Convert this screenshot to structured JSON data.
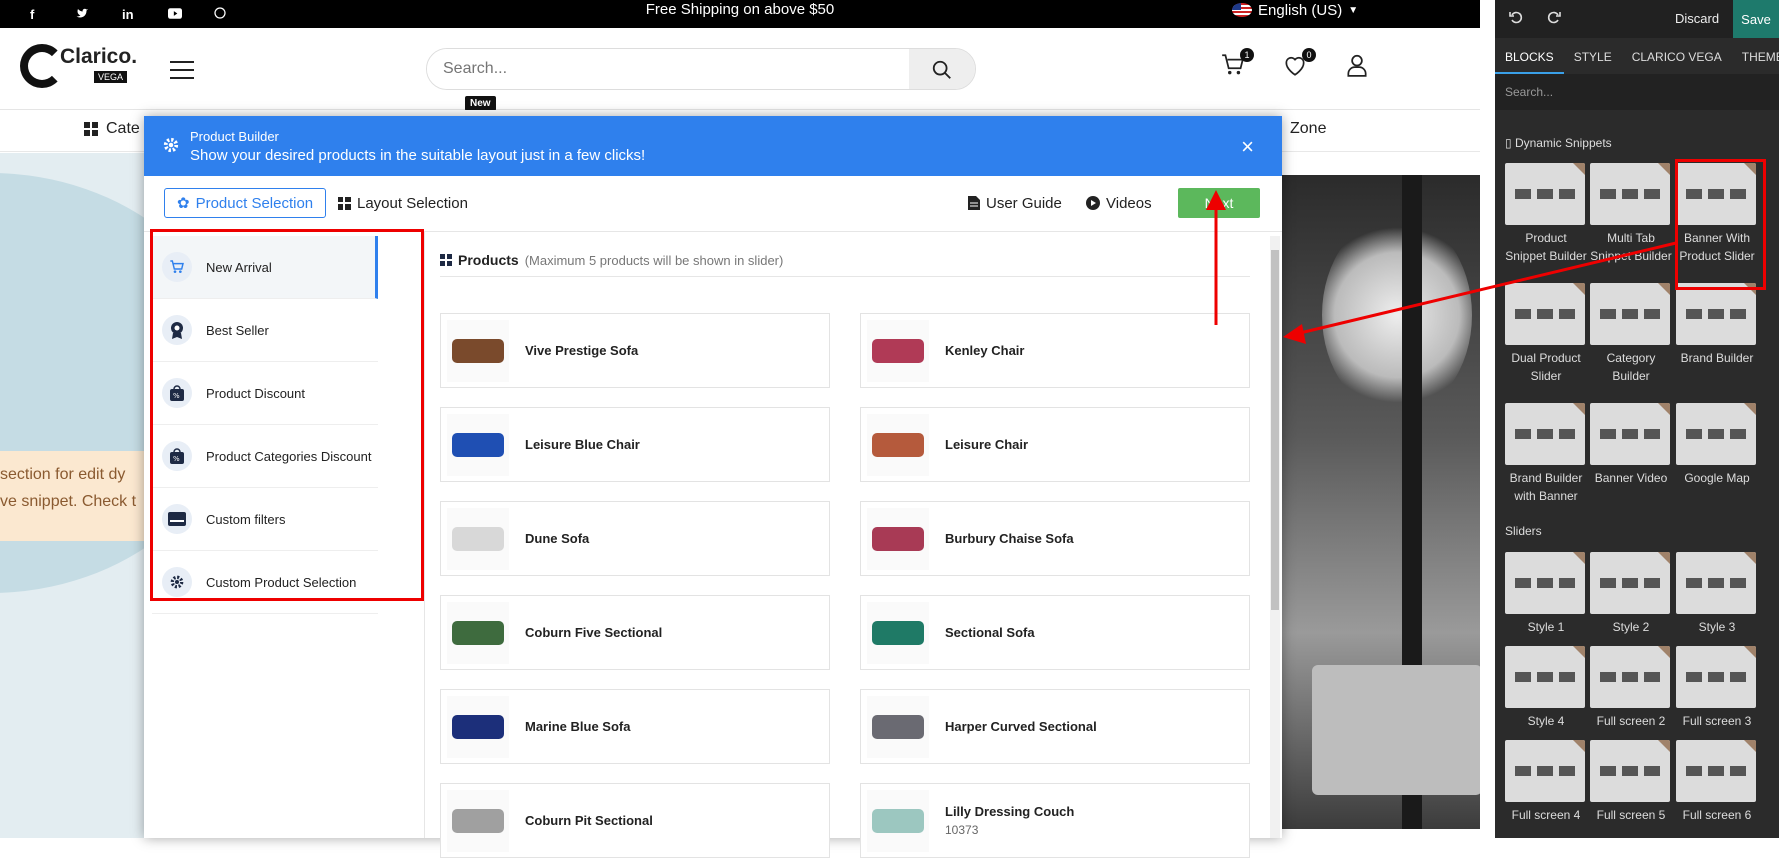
{
  "topbar": {
    "socials": [
      "f",
      "t",
      "in",
      "yt",
      "gh"
    ],
    "shipping": "Free Shipping on above $50",
    "language": "English (US)"
  },
  "header": {
    "logo_text": "Clarico.",
    "logo_badge": "VEGA",
    "search_placeholder": "Search...",
    "cart_count": "1",
    "wishlist_count": "0",
    "new_tag": "New"
  },
  "subnav": {
    "category_label": "Cate",
    "zone_label": "Zone"
  },
  "hero": {
    "notice_line1": "section for edit dy",
    "notice_line2": "ve snippet. Check t"
  },
  "modal": {
    "title": "Product Builder",
    "subtitle": "Show your desired products in the suitable layout just in a few clicks!",
    "tab_product_selection": "Product Selection",
    "tab_layout_selection": "Layout Selection",
    "user_guide": "User Guide",
    "videos": "Videos",
    "next": "Next",
    "close": "×",
    "products_title": "Products",
    "products_note": "(Maximum 5 products will be shown in slider)",
    "sidebar": [
      {
        "label": "New Arrival",
        "icon": "cart-icon"
      },
      {
        "label": "Best Seller",
        "icon": "award-icon"
      },
      {
        "label": "Product Discount",
        "icon": "discount-bag-icon"
      },
      {
        "label": "Product Categories Discount",
        "icon": "discount-bag-icon"
      },
      {
        "label": "Custom filters",
        "icon": "filter-card-icon"
      },
      {
        "label": "Custom Product Selection",
        "icon": "gear-icon"
      }
    ],
    "products": [
      {
        "name": "Vive Prestige Sofa",
        "color": "#7a4a2c"
      },
      {
        "name": "Kenley Chair",
        "color": "#b03a56"
      },
      {
        "name": "Leisure Blue Chair",
        "color": "#1f4fb3"
      },
      {
        "name": "Leisure Chair",
        "color": "#b55a3c"
      },
      {
        "name": "Dune Sofa",
        "color": "#d8d8d8"
      },
      {
        "name": "Burbury Chaise Sofa",
        "color": "#a83a55"
      },
      {
        "name": "Coburn Five Sectional",
        "color": "#3e6b3e"
      },
      {
        "name": "Sectional Sofa",
        "color": "#1f7a66"
      },
      {
        "name": "Marine Blue Sofa",
        "color": "#1c2f7a"
      },
      {
        "name": "Harper Curved Sectional",
        "color": "#6a6a72"
      },
      {
        "name": "Coburn Pit Sectional",
        "color": "#a0a0a0"
      },
      {
        "name": "Lilly Dressing Couch",
        "color": "#9cc7c0",
        "sub": "10373"
      }
    ]
  },
  "editor": {
    "discard": "Discard",
    "save": "Save",
    "tabs": [
      "BLOCKS",
      "STYLE",
      "CLARICO VEGA",
      "THEME"
    ],
    "search_placeholder": "Search...",
    "section_dynamic": "Dynamic Snippets",
    "section_sliders": "Sliders",
    "dynamic_blocks": [
      "Product Snippet Builder",
      "Multi Tab Snippet Builder",
      "Banner With Product Slider",
      "Dual Product Slider",
      "Category Builder",
      "Brand Builder",
      "Brand Builder with Banner",
      "Banner Video",
      "Google Map"
    ],
    "slider_blocks": [
      "Style 1",
      "Style 2",
      "Style 3",
      "Style 4",
      "Full screen 2",
      "Full screen 3",
      "Full screen 4",
      "Full screen 5",
      "Full screen 6"
    ]
  }
}
